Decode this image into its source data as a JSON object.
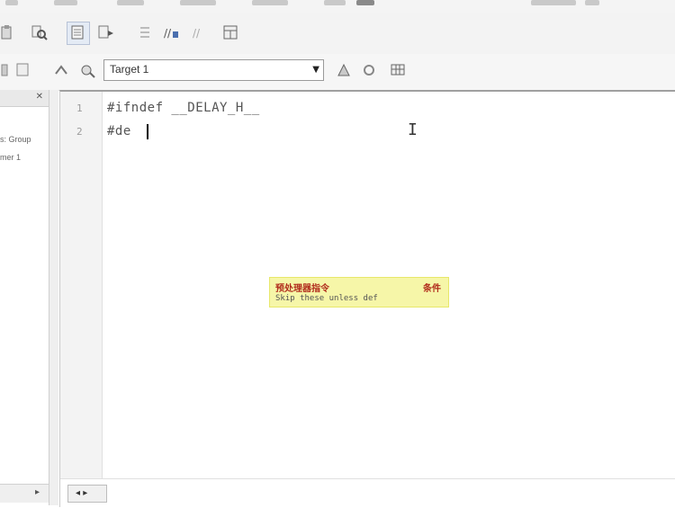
{
  "toolbar": {
    "target_select": {
      "value": "Target 1"
    }
  },
  "project_pane": {
    "tree_items": [
      "s: Group",
      "mer 1"
    ]
  },
  "editor": {
    "line_numbers": [
      "1",
      "2"
    ],
    "lines": [
      "#ifndef __DELAY_H__",
      "#de"
    ],
    "tooltip": {
      "title": "预处理器指令",
      "tag": "条件",
      "detail": "Skip these unless def"
    },
    "bottom_tab": {
      "label": "◂ ▸"
    }
  },
  "colors": {
    "tooltip_bg": "#f6f6a8",
    "tooltip_title": "#b12c1c",
    "code_text": "#555555",
    "gutter_bg": "#f3f3f3"
  },
  "icons": {
    "toolbar1": [
      "paste-icon",
      "find-icon",
      "bookmark-toggle-icon",
      "bookmark-next-icon",
      "indent-icon",
      "comment-icon",
      "uncomment-icon",
      "insert-icon"
    ],
    "toolbar2": [
      "compile-icon",
      "build-icon",
      "load-icon",
      "target-options-icon",
      "manage-icon",
      "settings-icon"
    ]
  }
}
